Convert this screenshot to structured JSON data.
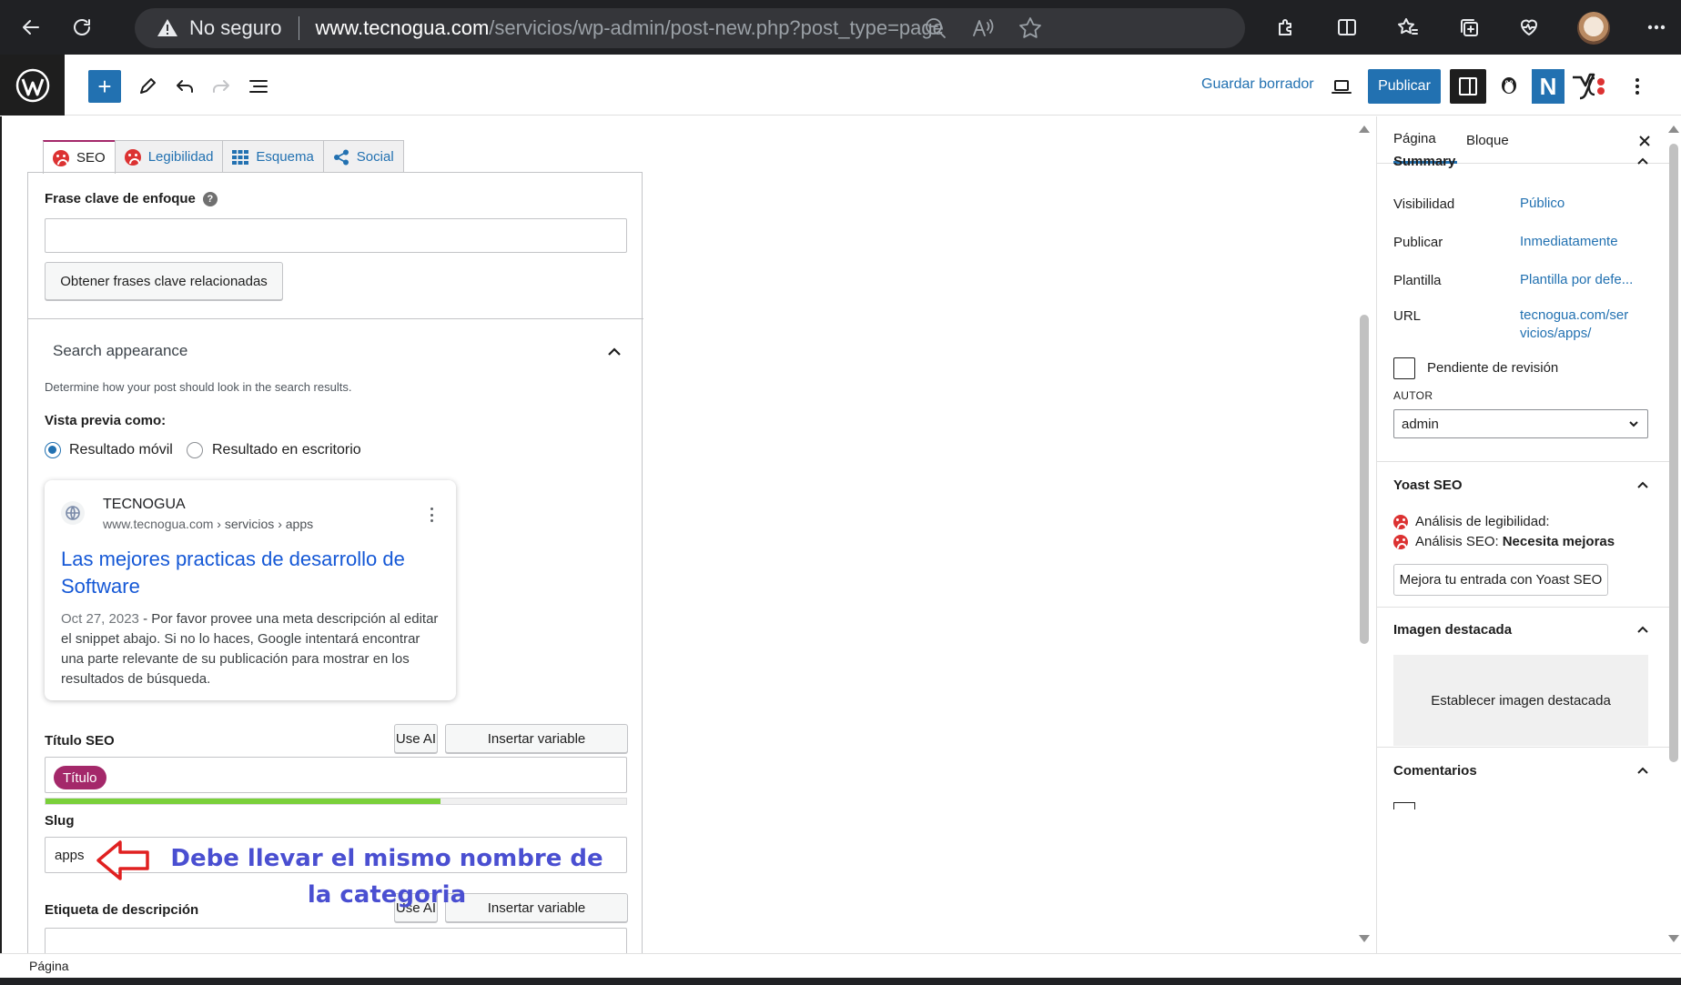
{
  "browser": {
    "security_label": "No seguro",
    "url_host": "www.tecnogua.com",
    "url_path": "/servicios/wp-admin/post-new.php?post_type=page"
  },
  "topbar": {
    "save_draft_label": "Guardar borrador",
    "publish_label": "Publicar",
    "plugin_badge": "N",
    "add_block_symbol": "+"
  },
  "yoast_tabs": [
    {
      "label": "SEO",
      "icon": "sad-face-icon"
    },
    {
      "label": "Legibilidad",
      "icon": "sad-face-icon"
    },
    {
      "label": "Esquema",
      "icon": "grid-icon"
    },
    {
      "label": "Social",
      "icon": "share-icon"
    }
  ],
  "seo": {
    "focus_keyphrase_label": "Frase clave de enfoque",
    "help_symbol": "?",
    "focus_keyphrase_value": "",
    "related_button_label": "Obtener frases clave relacionadas",
    "search_appearance_title": "Search appearance",
    "search_appearance_desc": "Determine how your post should look in the search results.",
    "preview_as_label": "Vista previa como:",
    "preview_mobile_label": "Resultado móvil",
    "preview_desktop_label": "Resultado en escritorio",
    "preview_selected": "mobile",
    "seo_title_label": "Título SEO",
    "use_ai_label": "Use AI",
    "insert_variable_label": "Insertar variable",
    "title_tag": "Título",
    "title_progress_fraction": 0.68,
    "slug_label": "Slug",
    "slug_value": "apps",
    "meta_desc_label": "Etiqueta de descripción",
    "annotation": "Debe llevar el mismo nombre de la categoria",
    "annotation_color": "#4a4fd1"
  },
  "snippet": {
    "site_name": "TECNOGUA",
    "url_host": "www.tecnogua.com",
    "url_path": " › servicios › apps",
    "title": "Las mejores practicas de desarrollo de Software",
    "date": "Oct 27, 2023",
    "date_sep": " - ",
    "description": "Por favor provee una meta descripción al editar el snippet abajo. Si no lo haces, Google intentará encontrar una parte relevante de su publicación para mostrar en los resultados de búsqueda."
  },
  "sidebar": {
    "tab_page": "Página",
    "tab_block": "Bloque",
    "summary_title": "Summary",
    "rows": [
      {
        "key": "Visibilidad",
        "value": "Público"
      },
      {
        "key": "Publicar",
        "value": "Inmediatamente"
      },
      {
        "key": "Plantilla",
        "value": "Plantilla por defe..."
      },
      {
        "key": "URL",
        "value": "tecnogua.com/servicios/apps/"
      }
    ],
    "pending_review_label": "Pendiente de revisión",
    "author_label": "AUTOR",
    "author_value": "admin",
    "yoast_title": "Yoast SEO",
    "readability_label": "Análisis de legibilidad:",
    "seo_analysis_label": "Análisis SEO:",
    "seo_analysis_value": "Necesita mejoras",
    "improve_button_label": "Mejora tu entrada con Yoast SEO",
    "featured_image_title": "Imagen destacada",
    "featured_image_button": "Establecer imagen destacada",
    "comments_title": "Comentarios"
  },
  "footer": {
    "breadcrumb": "Página"
  },
  "colors": {
    "wp_blue": "#2271b1",
    "yoast_purple": "#a4286a",
    "error_red": "#dc3232",
    "progress_green": "#7ad03a"
  }
}
